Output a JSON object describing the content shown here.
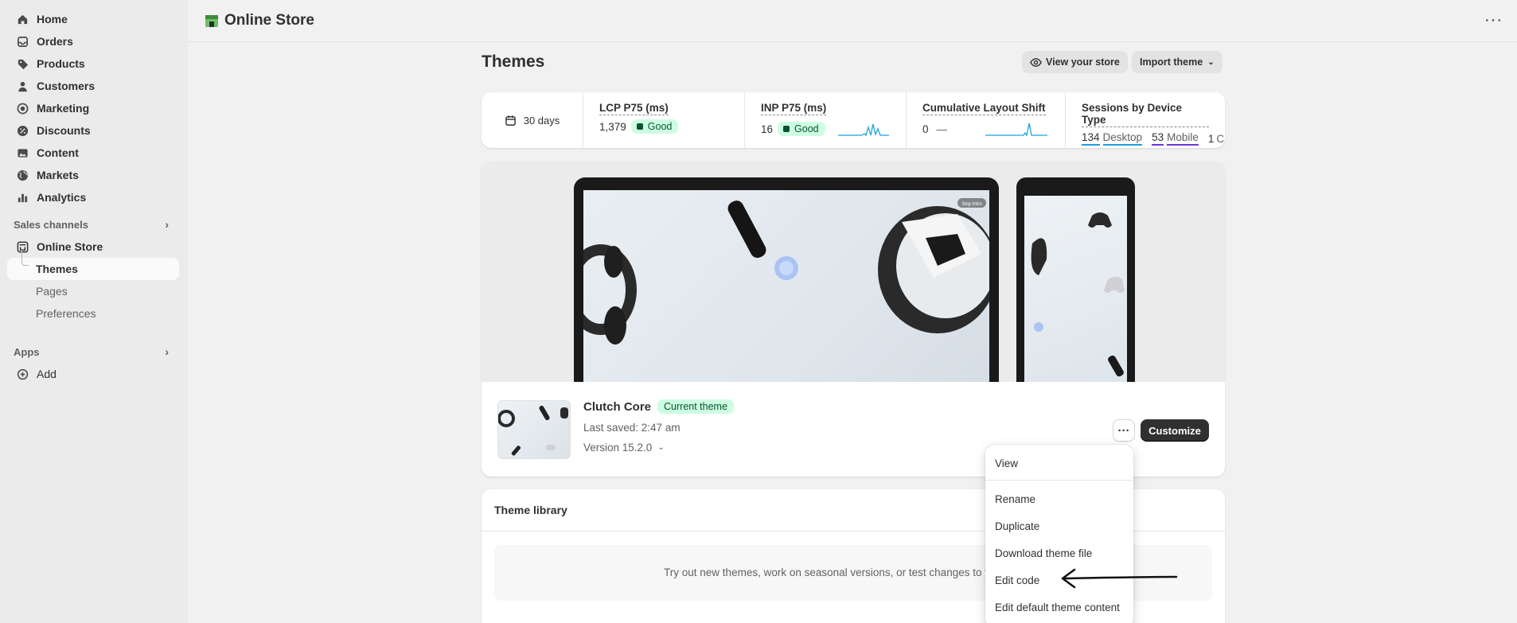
{
  "sidebar": {
    "nav": [
      {
        "label": "Home",
        "icon": "home-icon"
      },
      {
        "label": "Orders",
        "icon": "orders-icon"
      },
      {
        "label": "Products",
        "icon": "tag-icon"
      },
      {
        "label": "Customers",
        "icon": "person-icon"
      },
      {
        "label": "Marketing",
        "icon": "target-icon"
      },
      {
        "label": "Discounts",
        "icon": "discount-icon"
      },
      {
        "label": "Content",
        "icon": "image-icon"
      },
      {
        "label": "Markets",
        "icon": "globe-icon"
      },
      {
        "label": "Analytics",
        "icon": "bar-chart-icon"
      }
    ],
    "sales_channels_label": "Sales channels",
    "online_store_label": "Online Store",
    "sub_items": [
      "Themes",
      "Pages",
      "Preferences"
    ],
    "apps_label": "Apps",
    "add_label": "Add"
  },
  "topbar": {
    "title": "Online Store"
  },
  "page": {
    "title": "Themes",
    "view_store_label": "View your store",
    "import_theme_label": "Import theme"
  },
  "metrics": {
    "date_range": "30 days",
    "lcp": {
      "label": "LCP P75 (ms)",
      "value": "1,379",
      "status": "Good"
    },
    "inp": {
      "label": "INP P75 (ms)",
      "value": "16",
      "status": "Good"
    },
    "cls": {
      "label": "Cumulative Layout Shift",
      "value": "0",
      "status": "—"
    },
    "sessions": {
      "label": "Sessions by Device Type",
      "desktop_count": "134",
      "desktop_label": "Desktop",
      "mobile_count": "53",
      "mobile_label": "Mobile",
      "other_count": "1",
      "other_label": "C"
    }
  },
  "theme": {
    "name": "Clutch Core",
    "badge": "Current theme",
    "last_saved": "Last saved: 2:47 am",
    "version": "Version 15.2.0",
    "customize_label": "Customize",
    "skip_intro": "Skip Intro"
  },
  "library": {
    "title": "Theme library",
    "text": "Try out new themes, work on seasonal versions, or test changes to you"
  },
  "menu": {
    "items": [
      "View",
      "Rename",
      "Duplicate",
      "Download theme file",
      "Edit code",
      "Edit default theme content"
    ]
  },
  "colors": {
    "sidebar_bg": "#ebebeb",
    "page_bg": "#f1f1f1",
    "good_badge_bg": "#cdfee1",
    "good_badge_text": "#0c5132",
    "primary_button": "#303030",
    "desktop_underline": "#1f9ede",
    "mobile_underline": "#6d36d9",
    "sparkline": "#1ca3d6"
  }
}
